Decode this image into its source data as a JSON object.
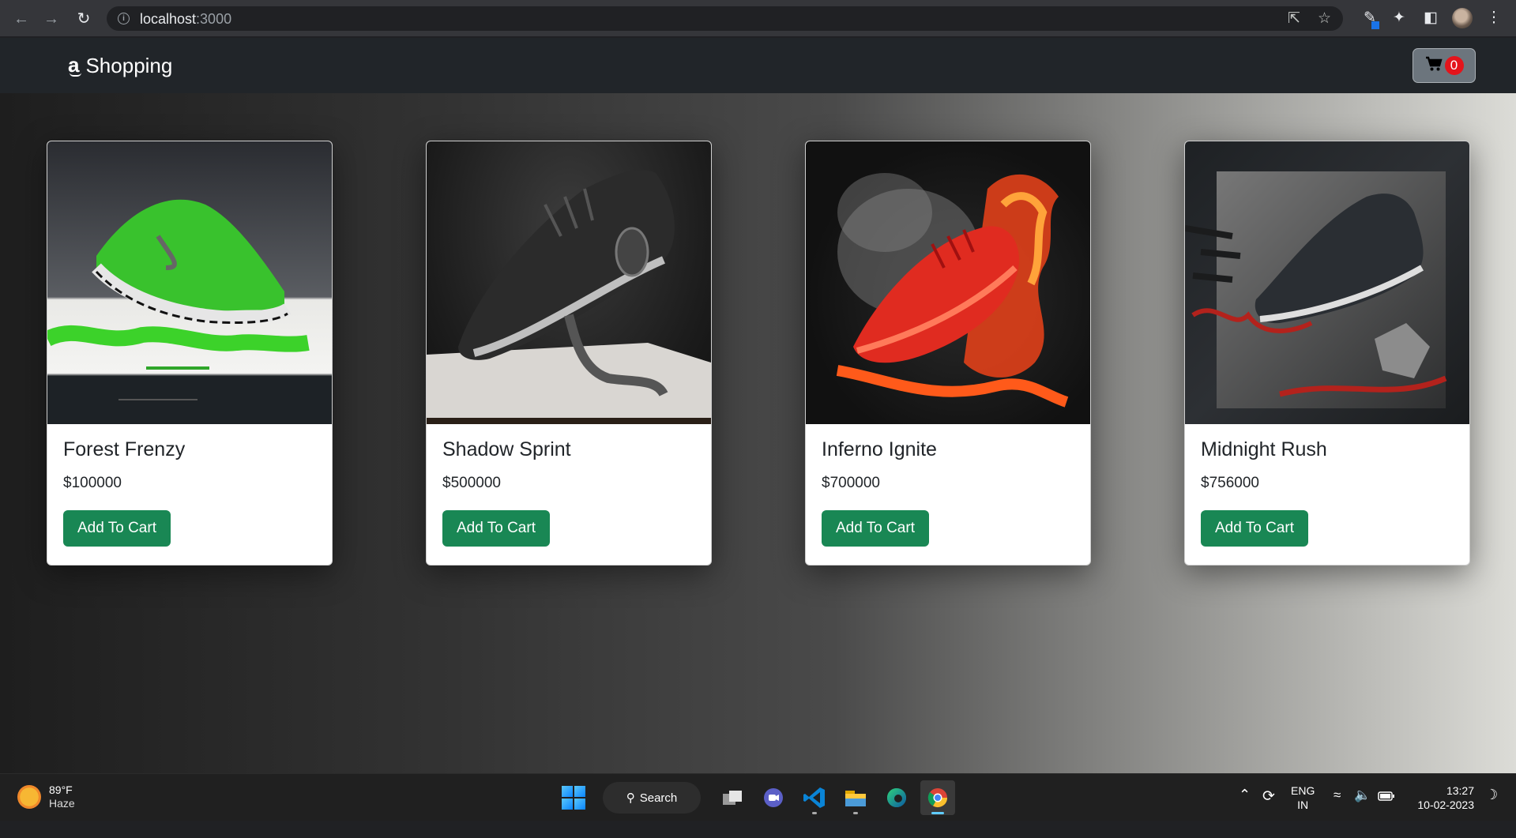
{
  "browser": {
    "url_host": "localhost",
    "url_port": ":3000"
  },
  "navbar": {
    "brand_logo": "a",
    "brand_name": "Shopping",
    "cart_count": "0"
  },
  "products": [
    {
      "name": "Forest Frenzy",
      "price": "$100000",
      "button": "Add To Cart"
    },
    {
      "name": "Shadow Sprint",
      "price": "$500000",
      "button": "Add To Cart"
    },
    {
      "name": "Inferno Ignite",
      "price": "$700000",
      "button": "Add To Cart"
    },
    {
      "name": "Midnight Rush",
      "price": "$756000",
      "button": "Add To Cart"
    }
  ],
  "taskbar": {
    "weather_temp": "89°F",
    "weather_condition": "Haze",
    "search_label": "Search",
    "lang_primary": "ENG",
    "lang_secondary": "IN",
    "time": "13:27",
    "date": "10-02-2023"
  },
  "colors": {
    "navbar_bg": "#212529",
    "add_button": "#198754",
    "cart_badge": "#e4141b"
  }
}
